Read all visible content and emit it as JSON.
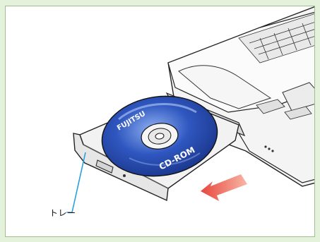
{
  "figure": {
    "callout_label": "トレー",
    "disc_brand": "FUJITSU",
    "disc_label": "CD-ROM",
    "colors": {
      "background_tint": "#e4f2dc",
      "disc_blue": "#1f3f9e",
      "callout_line": "#2a9fd8",
      "arrow_red": "#e8453c"
    }
  }
}
